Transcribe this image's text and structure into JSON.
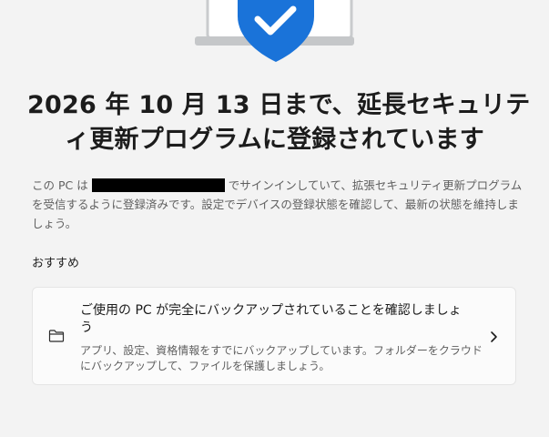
{
  "hero": {
    "illustration": "laptop-with-shield-check-icon",
    "accent_color": "#1a73d9"
  },
  "title_lines": [
    "2026 年 10 月 13 日まで、延長セキュリテ",
    "ィ更新プログラムに登録されています"
  ],
  "description": {
    "before_redaction": "この PC は",
    "after_redaction": "でサインインしていて、拡張セキュリティ更新プログラムを受信するように登録済みです。設定でデバイスの登録状態を確認して、最新の状態を維持しましょう。"
  },
  "recommended": {
    "label": "おすすめ",
    "card": {
      "icon": "folder-icon",
      "title": "ご使用の PC が完全にバックアップされていることを確認しましょう",
      "subtitle": "アプリ、設定、資格情報をすでにバックアップしています。フォルダーをクラウドにバックアップして、ファイルを保護しましょう。",
      "chevron": "chevron-right-icon"
    }
  }
}
